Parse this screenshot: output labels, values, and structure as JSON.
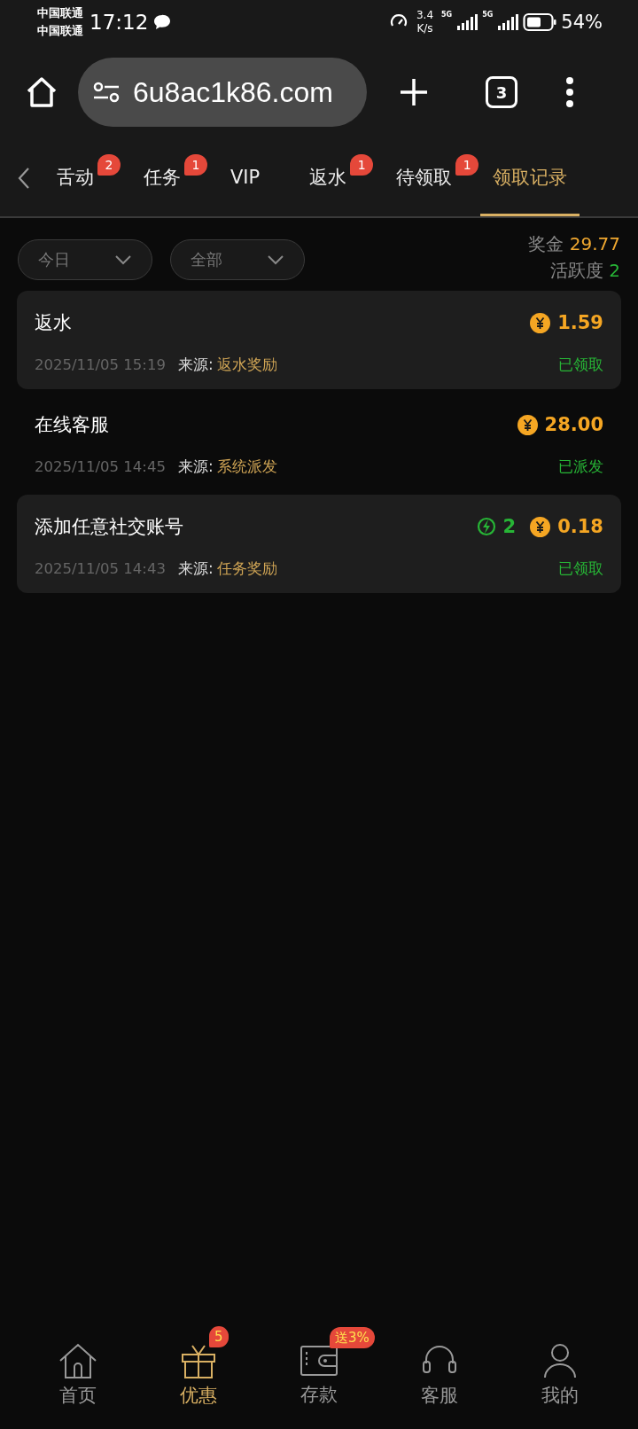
{
  "status_bar": {
    "carriers": [
      "中国联通",
      "中国联通"
    ],
    "time": "17:12",
    "speed_value": "3.4",
    "speed_unit": "K/s",
    "network_labels": [
      "5G",
      "5G"
    ],
    "battery": "54%"
  },
  "browser": {
    "url": "6u8ac1k86.com",
    "tab_count": "3"
  },
  "tabs": [
    {
      "label": "舌动",
      "badge": "2",
      "selected": false
    },
    {
      "label": "任务",
      "badge": "1",
      "selected": false
    },
    {
      "label": "VIP",
      "selected": false
    },
    {
      "label": "返水",
      "badge": "1",
      "selected": false
    },
    {
      "label": "待领取",
      "badge": "1",
      "selected": false
    },
    {
      "label": "领取记录",
      "selected": true
    }
  ],
  "filters": [
    {
      "value": "今日"
    },
    {
      "value": "全部"
    }
  ],
  "summary": {
    "bonus_label": "奖金",
    "bonus": "29.77",
    "activity_label": "活跃度",
    "activity": "2"
  },
  "records": [
    {
      "title": "返水",
      "shaded": true,
      "amount": "1.59",
      "time": "2025/11/05 15:19",
      "source_label": "来源:",
      "source": "返水奖励",
      "status": "已领取"
    },
    {
      "title": "在线客服",
      "shaded": false,
      "amount": "28.00",
      "time": "2025/11/05 14:45",
      "source_label": "来源:",
      "source": "系统派发",
      "status": "已派发"
    },
    {
      "title": "添加任意社交账号",
      "shaded": true,
      "activity": "2",
      "amount": "0.18",
      "time": "2025/11/05 14:43",
      "source_label": "来源:",
      "source": "任务奖励",
      "status": "已领取"
    }
  ],
  "nav": [
    {
      "label": "首页",
      "kind": "home",
      "selected": false
    },
    {
      "label": "优惠",
      "kind": "gift",
      "badge": "5",
      "selected": true
    },
    {
      "label": "存款",
      "kind": "wallet",
      "badge": "送3%",
      "selected": false
    },
    {
      "label": "客服",
      "kind": "support",
      "selected": false
    },
    {
      "label": "我的",
      "kind": "profile",
      "selected": false
    }
  ]
}
